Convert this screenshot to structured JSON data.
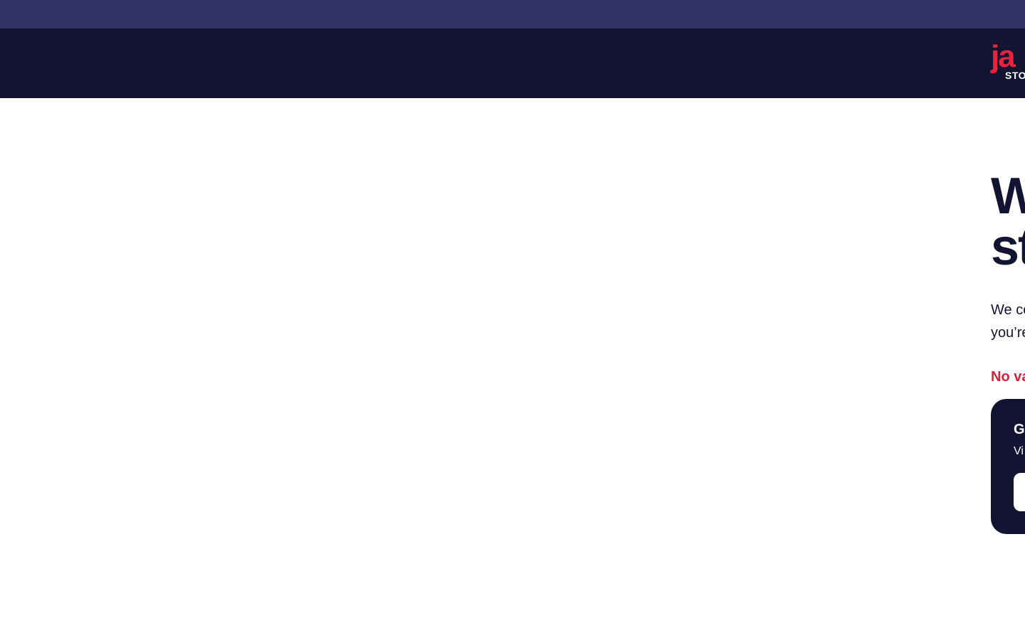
{
  "announcement_bar": {
    "text": ""
  },
  "header": {
    "logo": {
      "wordmark": "ja",
      "subtext": "STO"
    }
  },
  "main": {
    "headline_line1": "W",
    "headline_line2": "st",
    "intro_line1": "We co",
    "intro_line2": "you’re",
    "error_message": "No va",
    "promo_card": {
      "title": "Go",
      "text": "Vi",
      "button_label": ""
    }
  },
  "colors": {
    "announcement_bg": "#2e3264",
    "header_bg": "#131432",
    "brand_red": "#e8243c",
    "error_red": "#d8213f",
    "text_dark": "#131432",
    "card_bg": "#131432"
  }
}
